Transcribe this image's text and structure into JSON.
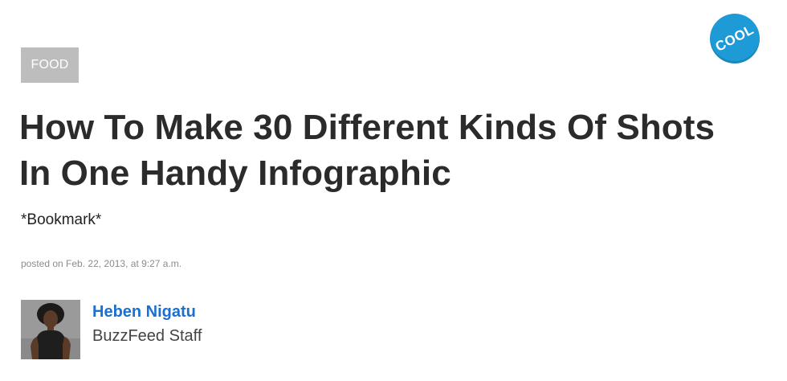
{
  "category": {
    "label": "FOOD"
  },
  "badge": {
    "label": "COOL",
    "color": "#1e9bd6"
  },
  "article": {
    "title": "How To Make 30 Different Kinds Of Shots In One Handy Infographic",
    "subtitle": "*Bookmark*",
    "dateline": "posted on Feb. 22, 2013, at 9:27 a.m."
  },
  "author": {
    "name": "Heben Nigatu",
    "role": "BuzzFeed Staff",
    "avatar_icon": "author-photo",
    "link_color": "#1a6fd0"
  },
  "colors": {
    "tag_bg": "#bdbdbd",
    "headline": "#2b2b2b",
    "muted": "#8c8c8c"
  }
}
